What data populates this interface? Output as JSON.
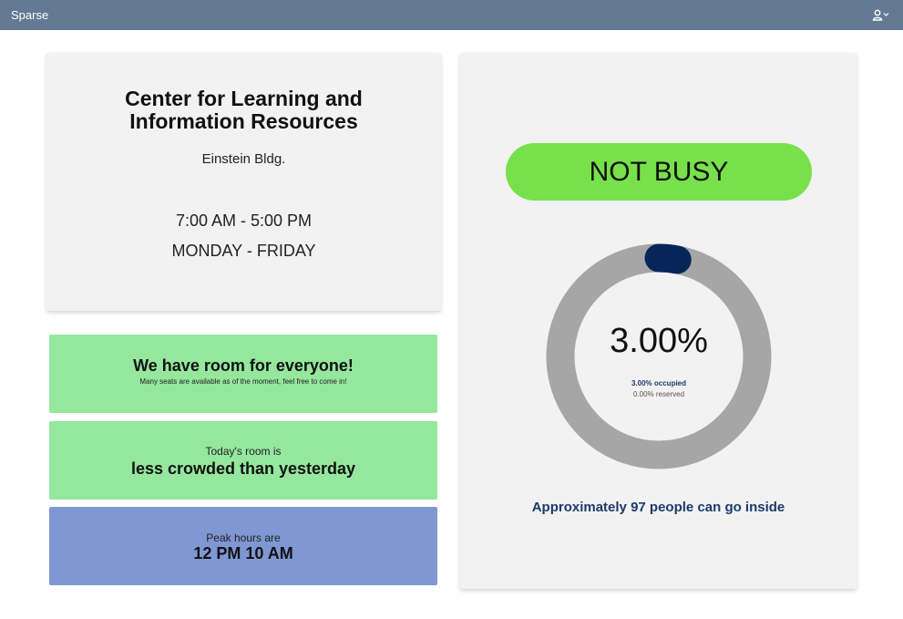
{
  "app": {
    "brand": "Sparse",
    "user_icon": "user-icon",
    "chevron_icon": "chevron-down-icon"
  },
  "location": {
    "name": "Center for Learning and Information Resources",
    "building": "Einstein Bldg.",
    "hours": "7:00 AM  -  5:00 PM",
    "days": "MONDAY  -  FRIDAY"
  },
  "messages": {
    "room": {
      "headline": "We have room for everyone!",
      "detail": "Many seats are available as of the moment, feel free to come in!"
    },
    "comparison": {
      "prefix": "Today's room is",
      "value": "less crowded than yesterday"
    },
    "peak": {
      "prefix": "Peak hours are",
      "value": "12 PM 10 AM"
    }
  },
  "status": {
    "label": "NOT BUSY",
    "occupancy_fraction": 0.03,
    "reserved_fraction": 0.0,
    "occupancy_text": "3.00%",
    "occupied_text": "3.00% occupied",
    "reserved_text": "0.00% reserved",
    "capacity_text": "Approximately 97 people can go inside"
  },
  "colors": {
    "topbar": "#647993",
    "card": "#f2f2f2",
    "status_green": "#78e04b",
    "message_green": "#95e79e",
    "peak_blue": "#7f97d3",
    "gauge_track": "#a6a6a6",
    "gauge_fill": "#062659",
    "text_navy": "#1d3a6a"
  }
}
